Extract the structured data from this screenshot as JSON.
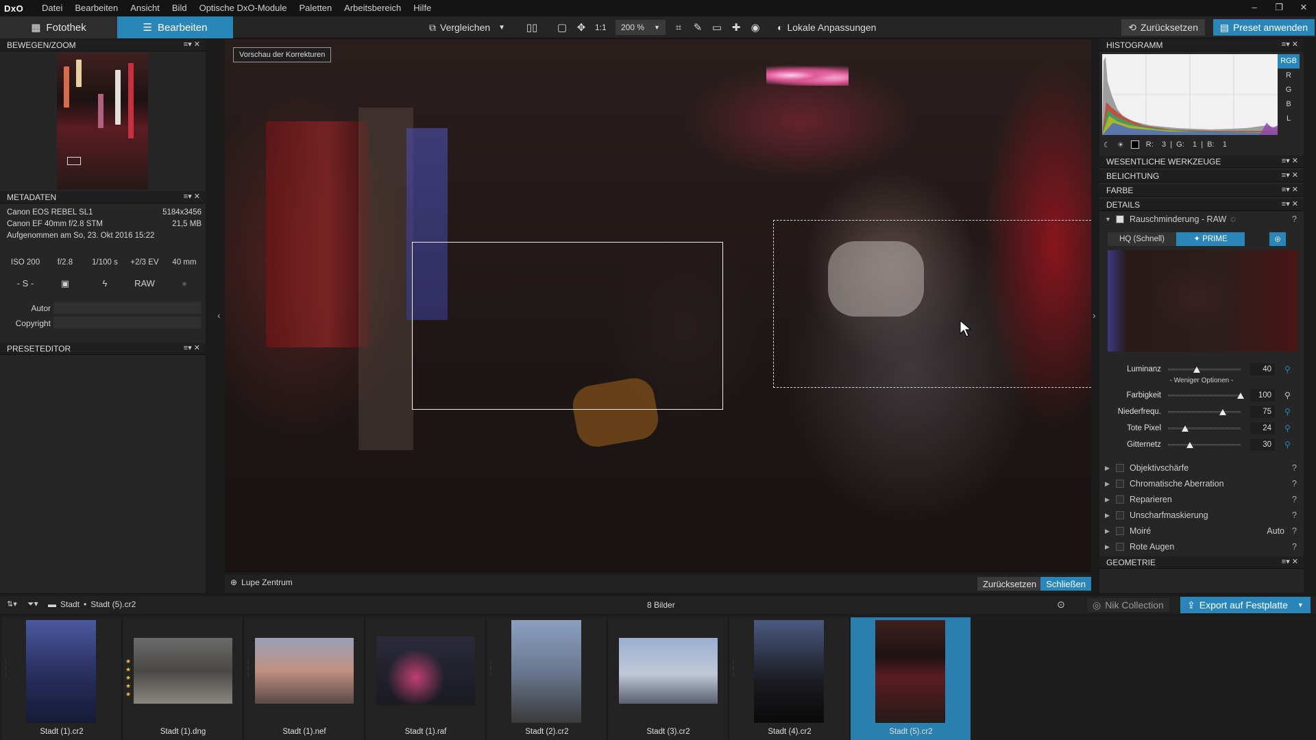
{
  "app": {
    "logo": "DxO",
    "menu": [
      "Datei",
      "Bearbeiten",
      "Ansicht",
      "Bild",
      "Optische DxO-Module",
      "Paletten",
      "Arbeitsbereich",
      "Hilfe"
    ]
  },
  "toolbar": {
    "tab_library": "Fotothek",
    "tab_edit": "Bearbeiten",
    "compare": "Vergleichen",
    "zoom_11": "1:1",
    "zoom_value": "200 %",
    "local_adjust": "Lokale Anpassungen",
    "reset": "Zurücksetzen",
    "apply_preset": "Preset anwenden"
  },
  "left": {
    "move_zoom": {
      "title": "BEWEGEN/ZOOM"
    },
    "metadata": {
      "title": "METADATEN",
      "camera": "Canon EOS REBEL SL1",
      "dimensions": "5184x3456",
      "lens": "Canon EF 40mm f/2.8 STM",
      "filesize": "21,5 MB",
      "date": "Aufgenommen am So, 23. Okt 2016 15:22",
      "iso": "ISO 200",
      "aperture": "f/2.8",
      "shutter": "1/100 s",
      "ev": "+2/3 EV",
      "focal": "40 mm",
      "mode": "- S -",
      "raw": "RAW",
      "author_label": "Autor",
      "author_value": "",
      "copyright_label": "Copyright",
      "copyright_value": ""
    },
    "preset_editor": {
      "title": "PRESETEDITOR"
    }
  },
  "viewer": {
    "preview_label": "Vorschau der Korrekturen",
    "loupe_label": "Lupe Zentrum",
    "reset": "Zurücksetzen",
    "close": "Schließen"
  },
  "right": {
    "histogram": {
      "title": "HISTOGRAMM",
      "channels": [
        "RGB",
        "R",
        "G",
        "B",
        "L"
      ],
      "active_channel": "RGB",
      "readout": "R:    3  |  G:    1  |  B:    1"
    },
    "sections": {
      "essential": "WESENTLICHE WERKZEUGE",
      "exposure": "BELICHTUNG",
      "color": "FARBE",
      "details": "DETAILS",
      "geometry": "GEOMETRIE"
    },
    "noise": {
      "title": "Rauschminderung - RAW",
      "mode_hq": "HQ (Schnell)",
      "mode_prime": "✦ PRIME",
      "less_options": "- Weniger Optionen -",
      "sliders": [
        {
          "label": "Luminanz",
          "value": "40",
          "fraction": 0.4
        },
        {
          "label": "Farbigkeit",
          "value": "100",
          "fraction": 1.0
        },
        {
          "label": "Niederfrequ.",
          "value": "75",
          "fraction": 0.75
        },
        {
          "label": "Tote Pixel",
          "value": "24",
          "fraction": 0.24
        },
        {
          "label": "Gitternetz",
          "value": "30",
          "fraction": 0.3
        }
      ]
    },
    "subsections": [
      {
        "label": "Objektivschärfe",
        "extra": ""
      },
      {
        "label": "Chromatische Aberration",
        "extra": ""
      },
      {
        "label": "Reparieren",
        "extra": ""
      },
      {
        "label": "Unscharfmaskierung",
        "extra": ""
      },
      {
        "label": "Moiré",
        "extra": "Auto"
      },
      {
        "label": "Rote Augen",
        "extra": ""
      }
    ]
  },
  "filmstrip": {
    "breadcrumb_folder": "Stadt",
    "breadcrumb_file": "Stadt (5).cr2",
    "count": "8 Bilder",
    "nik": "Nik Collection",
    "export": "Export auf Festplatte",
    "items": [
      {
        "name": "Stadt (1).cr2",
        "stars": 0
      },
      {
        "name": "Stadt (1).dng",
        "stars": 5
      },
      {
        "name": "Stadt (1).nef",
        "stars": 0
      },
      {
        "name": "Stadt (1).raf",
        "stars": 0
      },
      {
        "name": "Stadt (2).cr2",
        "stars": 0
      },
      {
        "name": "Stadt (3).cr2",
        "stars": 0
      },
      {
        "name": "Stadt (4).cr2",
        "stars": 0
      },
      {
        "name": "Stadt (5).cr2",
        "stars": 0
      }
    ],
    "selected_index": 7
  },
  "colors": {
    "accent": "#2a86b8",
    "panel": "#262627"
  }
}
